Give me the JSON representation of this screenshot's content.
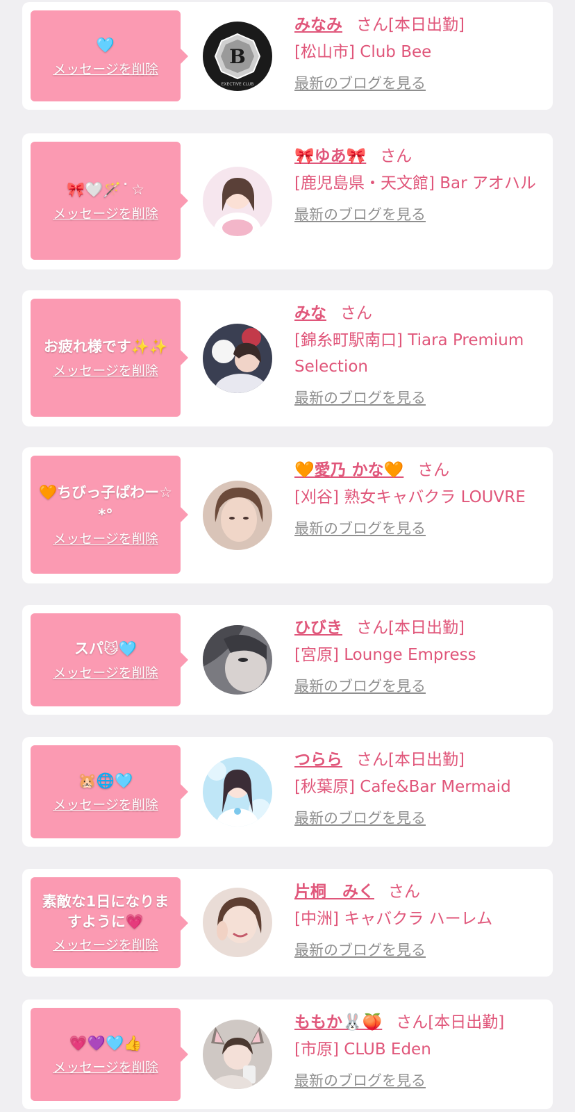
{
  "delete_label": "メッセージを削除",
  "blog_label": "最新のブログを見る",
  "san_label": "さん",
  "colors": {
    "background": "#f0eff2",
    "card": "#ffffff",
    "bubble": "#fb9ab2",
    "accent": "#e0567a",
    "link_gray": "#8f8f8f"
  },
  "cards": [
    {
      "message": "🩵",
      "name": "みなみ",
      "status": "[本日出勤]",
      "shop": "[松山市] Club Bee",
      "avatar": "club-bee-logo",
      "avatar_text": "B",
      "avatar_subtext": "EXECTIVE CLUB"
    },
    {
      "message": "🎀🤍🪄 ͘ ☆",
      "name": "🎀ゆあ🎀",
      "status": "",
      "shop": "[鹿児島県・天文館] Bar アオハル",
      "avatar": "cast-photo"
    },
    {
      "message": "お疲れ様です✨✨",
      "name": "みな",
      "status": "",
      "shop": "[錦糸町駅南口] Tiara Premium Selection",
      "avatar": "cast-photo"
    },
    {
      "message": "🧡ちびっ子ぱわー☆*°",
      "name": "🧡愛乃 かな🧡",
      "status": "",
      "shop": "[刈谷] 熟女キャバクラ LOUVRE",
      "avatar": "cast-photo"
    },
    {
      "message": "スパ😼🩵",
      "name": "ひびき",
      "status": "[本日出勤]",
      "shop": "[宮原] Lounge Empress",
      "avatar": "cast-photo"
    },
    {
      "message": "🐹🌐🩵",
      "name": "つらら",
      "status": "[本日出勤]",
      "shop": "[秋葉原] Cafe&Bar Mermaid",
      "avatar": "cast-photo"
    },
    {
      "message": "素敵な1日になりますように💗",
      "name": "片桐　みく",
      "status": "",
      "shop": "[中洲] キャバクラ ハーレム",
      "avatar": "cast-photo"
    },
    {
      "message": "💗💜🩵👍",
      "name": "ももか🐰🍑",
      "status": "[本日出勤]",
      "shop": "[市原] CLUB Eden",
      "avatar": "cast-photo"
    }
  ]
}
